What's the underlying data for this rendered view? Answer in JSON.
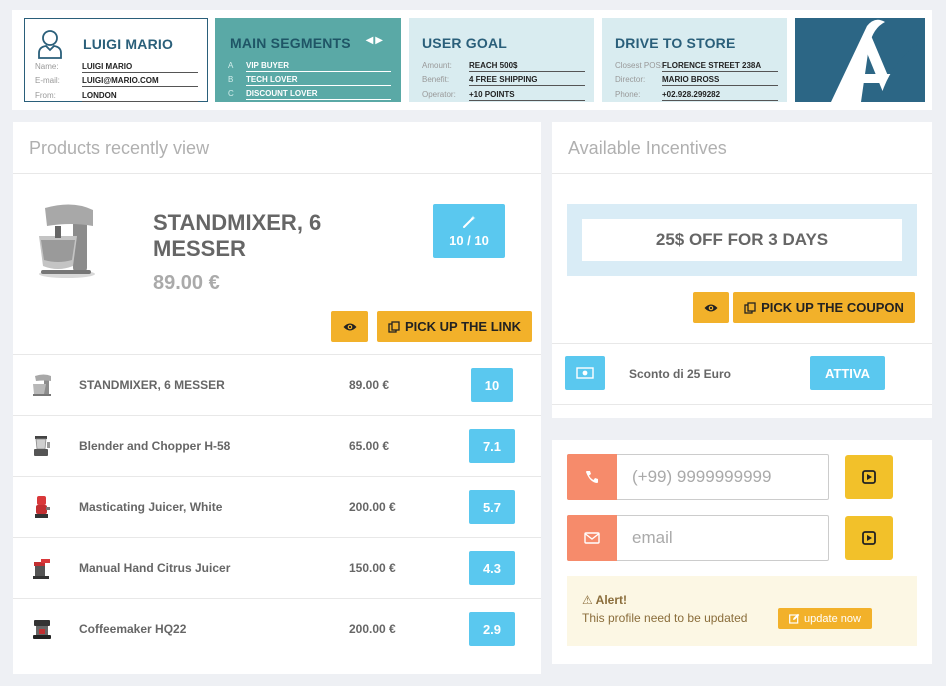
{
  "profile": {
    "name_title": "LUIGI MARIO",
    "fields": [
      {
        "label": "Name:",
        "value": "LUIGI MARIO"
      },
      {
        "label": "E-mail:",
        "value": "LUIGI@MARIO.COM"
      },
      {
        "label": "From:",
        "value": "LONDON"
      }
    ]
  },
  "segments": {
    "title": "MAIN SEGMENTS",
    "items": [
      {
        "key": "A",
        "value": "VIP BUYER"
      },
      {
        "key": "B",
        "value": "TECH LOVER"
      },
      {
        "key": "C",
        "value": "DISCOUNT LOVER"
      }
    ]
  },
  "user_goal": {
    "title": "USER GOAL",
    "fields": [
      {
        "label": "Amount:",
        "value": "REACH 500$"
      },
      {
        "label": "Benefit:",
        "value": "4 FREE SHIPPING"
      },
      {
        "label": "Operator:",
        "value": "+10 POINTS"
      }
    ]
  },
  "drive_to_store": {
    "title": "DRIVE TO STORE",
    "fields": [
      {
        "label": "Closest POS:",
        "value": "FLORENCE STREET 238A"
      },
      {
        "label": "Director:",
        "value": "MARIO BROSS"
      },
      {
        "label": "Phone:",
        "value": "+02.928.299282"
      }
    ]
  },
  "logo": {
    "letter": "A"
  },
  "products": {
    "title": "Products recently view",
    "featured": {
      "name": "STANDMIXER, 6 MESSER",
      "price": "89.00 €",
      "score": "10 / 10",
      "pick_link_label": "PICK UP THE LINK"
    },
    "items": [
      {
        "name": "STANDMIXER, 6 MESSER",
        "price": "89.00 €",
        "score": "10"
      },
      {
        "name": "Blender and Chopper H-58",
        "price": "65.00 €",
        "score": "7.1"
      },
      {
        "name": "Masticating Juicer, White",
        "price": "200.00 €",
        "score": "5.7"
      },
      {
        "name": "Manual Hand Citrus Juicer",
        "price": "150.00 €",
        "score": "4.3"
      },
      {
        "name": "Coffeemaker HQ22",
        "price": "200.00 €",
        "score": "2.9"
      }
    ]
  },
  "incentives": {
    "title": "Available Incentives",
    "coupon_text": "25$ OFF FOR 3 DAYS",
    "pick_coupon_label": "PICK UP THE COUPON",
    "row": {
      "label": "Sconto di 25 Euro",
      "action": "ATTIVA"
    }
  },
  "contact": {
    "phone_placeholder": "(+99) 9999999999",
    "email_placeholder": "email",
    "alert_title": "Alert!",
    "alert_text": "This profile need to be updated",
    "update_label": "update now"
  },
  "colors": {
    "teal": "#5aa9a6",
    "navy": "#2a5f7a",
    "light_blue": "#d9ecf0",
    "sky": "#5ac8ef",
    "orange": "#f2b12a",
    "coral": "#f68b6b"
  }
}
